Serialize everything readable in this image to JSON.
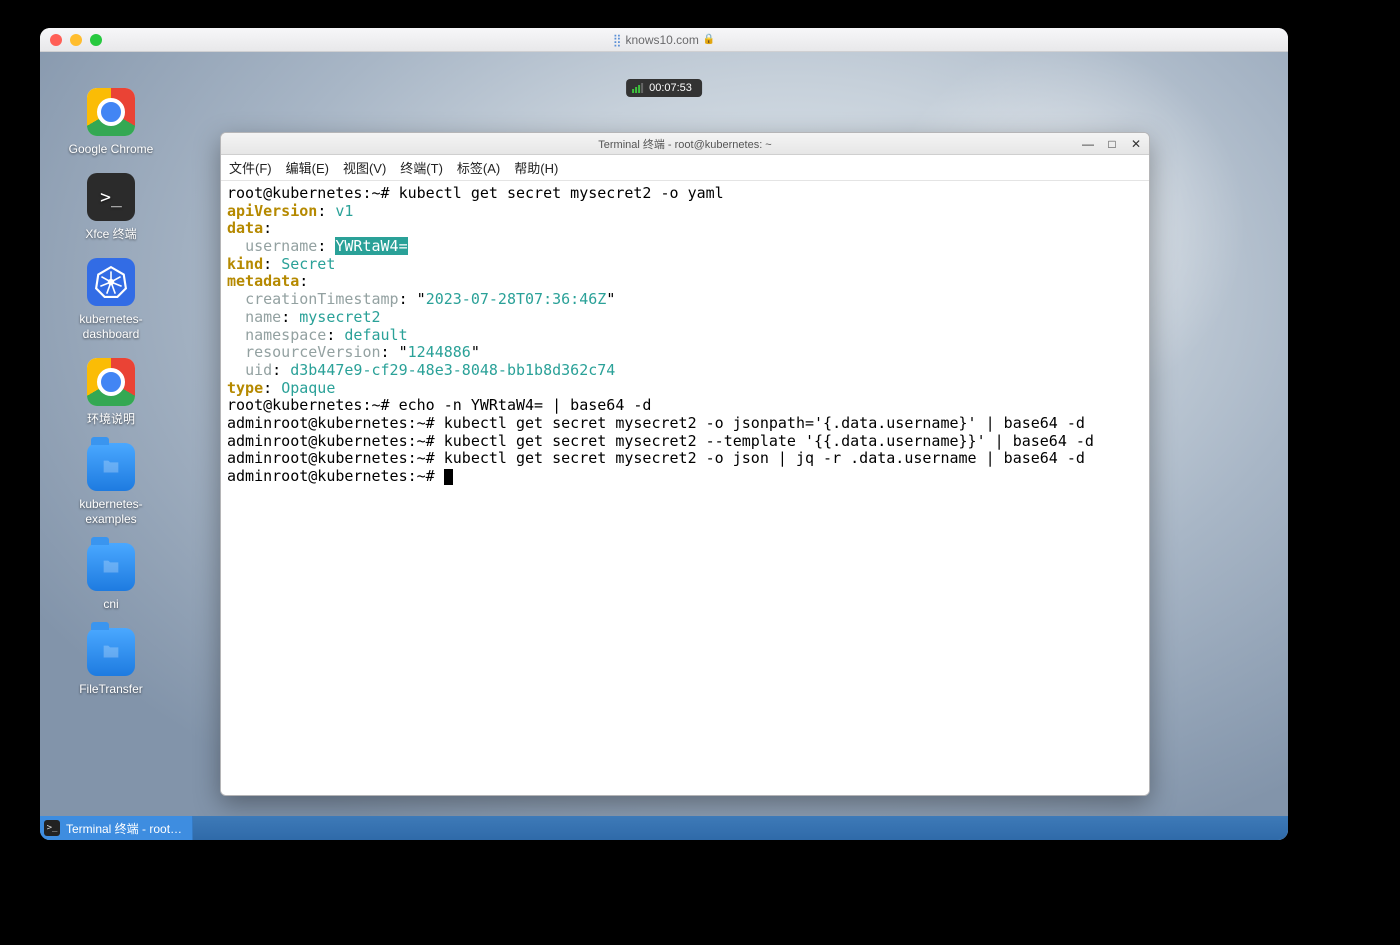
{
  "mac": {
    "url": "knows10.com"
  },
  "timer": "00:07:53",
  "desktop_icons": [
    {
      "label": "Google Chrome"
    },
    {
      "label": "Xfce 终端"
    },
    {
      "label": "kubernetes-\ndashboard"
    },
    {
      "label": "环境说明"
    },
    {
      "label": "kubernetes-\nexamples"
    },
    {
      "label": "cni"
    },
    {
      "label": "FileTransfer"
    }
  ],
  "terminal": {
    "title": "Terminal 终端 - root@kubernetes: ~",
    "menu": [
      "文件(F)",
      "编辑(E)",
      "视图(V)",
      "终端(T)",
      "标签(A)",
      "帮助(H)"
    ],
    "prompt": "root@kubernetes:~#",
    "cmd1": "kubectl get secret mysecret2 -o yaml",
    "yaml": {
      "apiVersion": "v1",
      "username_b64": "YWRtaW4=",
      "kind": "Secret",
      "creationTimestamp": "2023-07-28T07:36:46Z",
      "name": "mysecret2",
      "namespace": "default",
      "resourceVersion": "1244886",
      "uid": "d3b447e9-cf29-48e3-8048-bb1b8d362c74",
      "type": "Opaque"
    },
    "cmd2": "echo -n YWRtaW4= | base64 -d",
    "out_prefix": "admin",
    "cmd3": "kubectl get secret mysecret2 -o jsonpath='{.data.username}' | base64 -d",
    "cmd4": "kubectl get secret mysecret2 --template '{{.data.username}}' | base64 -d",
    "cmd5": "kubectl get secret mysecret2 -o json | jq -r .data.username | base64 -d"
  },
  "taskbar": {
    "item": "Terminal 终端 - root…"
  }
}
